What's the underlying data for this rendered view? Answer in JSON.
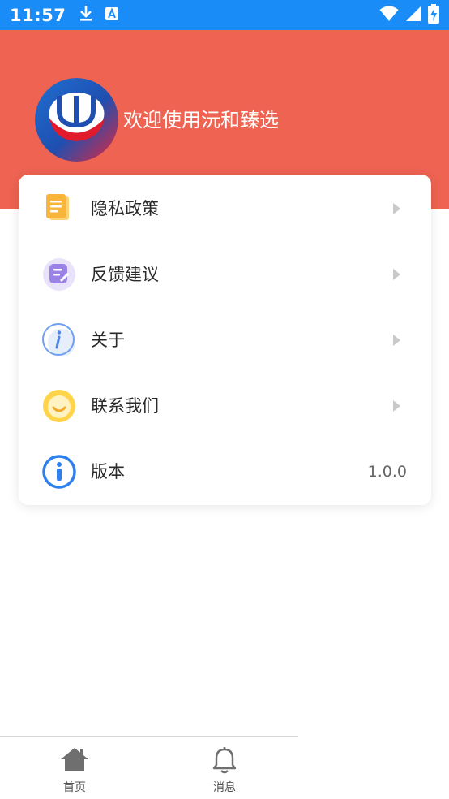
{
  "status_bar": {
    "time": "11:57",
    "icons": [
      "download-icon",
      "app-notification-icon",
      "wifi-icon",
      "signal-icon",
      "battery-charging-icon"
    ]
  },
  "header": {
    "welcome_text": "欢迎使用沅和臻选",
    "background_color": "#ee6352"
  },
  "menu": {
    "items": [
      {
        "label": "隐私政策",
        "icon": "document-icon",
        "has_arrow": true
      },
      {
        "label": "反馈建议",
        "icon": "feedback-icon",
        "has_arrow": true
      },
      {
        "label": "关于",
        "icon": "info-outline-icon",
        "has_arrow": true
      },
      {
        "label": "联系我们",
        "icon": "chat-smile-icon",
        "has_arrow": true
      },
      {
        "label": "版本",
        "icon": "info-filled-icon",
        "value": "1.0.0",
        "has_arrow": false
      }
    ]
  },
  "bottom_nav": {
    "tabs": [
      {
        "label": "首页",
        "icon": "home-icon"
      },
      {
        "label": "消息",
        "icon": "bell-icon"
      }
    ]
  },
  "colors": {
    "status_bar": "#1a8cf8",
    "accent": "#ee6352"
  }
}
